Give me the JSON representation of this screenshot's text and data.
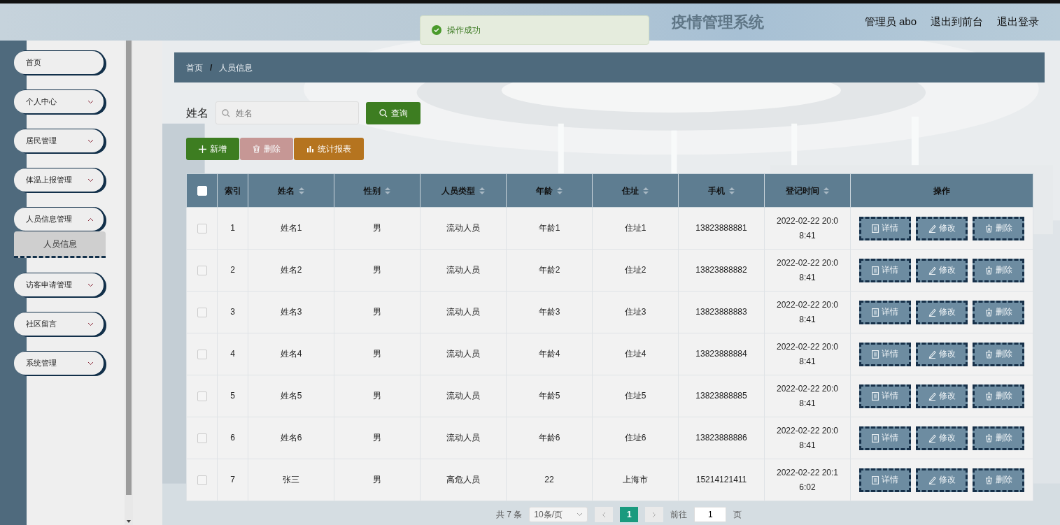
{
  "header": {
    "title": "疫情管理系统",
    "toast": {
      "kind": "success",
      "text": "操作成功"
    },
    "user_links": [
      "管理员 abo",
      "退出到前台",
      "退出登录"
    ]
  },
  "sidebar": {
    "items": [
      {
        "label": "首页",
        "kind": "link"
      },
      {
        "label": "个人中心",
        "kind": "submenu",
        "expanded": false
      },
      {
        "label": "居民管理",
        "kind": "submenu",
        "expanded": false
      },
      {
        "label": "体温上报管理",
        "kind": "submenu",
        "expanded": false
      },
      {
        "label": "人员信息管理",
        "kind": "submenu",
        "expanded": true,
        "children": [
          {
            "label": "人员信息",
            "selected": true
          }
        ]
      },
      {
        "label": "访客申请管理",
        "kind": "submenu",
        "expanded": false
      },
      {
        "label": "社区留言",
        "kind": "submenu",
        "expanded": false
      },
      {
        "label": "系统管理",
        "kind": "submenu",
        "expanded": false
      }
    ]
  },
  "breadcrumb": [
    "首页",
    "人员信息"
  ],
  "breadcrumb_separator": "/",
  "search": {
    "label": "姓名",
    "placeholder": "姓名",
    "button": "查询"
  },
  "toolbar_buttons": [
    {
      "label": "新增",
      "kind": "add",
      "disabled": false
    },
    {
      "label": "删除",
      "kind": "delete",
      "disabled": true
    },
    {
      "label": "统计报表",
      "kind": "report",
      "disabled": false
    }
  ],
  "table": {
    "select_all_checked": false,
    "columns": [
      {
        "label": "索引",
        "sortable": false
      },
      {
        "label": "姓名",
        "sortable": true
      },
      {
        "label": "性别",
        "sortable": true
      },
      {
        "label": "人员类型",
        "sortable": true
      },
      {
        "label": "年龄",
        "sortable": true
      },
      {
        "label": "住址",
        "sortable": true
      },
      {
        "label": "手机",
        "sortable": true
      },
      {
        "label": "登记时间",
        "sortable": true
      },
      {
        "label": "操作",
        "sortable": false
      }
    ],
    "rows": [
      {
        "checked": false,
        "cells": [
          "1",
          "姓名1",
          "男",
          "流动人员",
          "年龄1",
          "住址1",
          "13823888881",
          "2022-02-22 20:08:41"
        ],
        "actions": [
          {
            "label": "详情",
            "kind": "detail"
          },
          {
            "label": "修改",
            "kind": "edit"
          },
          {
            "label": "删除",
            "kind": "delete"
          }
        ]
      },
      {
        "checked": false,
        "cells": [
          "2",
          "姓名2",
          "男",
          "流动人员",
          "年龄2",
          "住址2",
          "13823888882",
          "2022-02-22 20:08:41"
        ],
        "actions": [
          {
            "label": "详情",
            "kind": "detail"
          },
          {
            "label": "修改",
            "kind": "edit"
          },
          {
            "label": "删除",
            "kind": "delete"
          }
        ]
      },
      {
        "checked": false,
        "cells": [
          "3",
          "姓名3",
          "男",
          "流动人员",
          "年龄3",
          "住址3",
          "13823888883",
          "2022-02-22 20:08:41"
        ],
        "actions": [
          {
            "label": "详情",
            "kind": "detail"
          },
          {
            "label": "修改",
            "kind": "edit"
          },
          {
            "label": "删除",
            "kind": "delete"
          }
        ]
      },
      {
        "checked": false,
        "cells": [
          "4",
          "姓名4",
          "男",
          "流动人员",
          "年龄4",
          "住址4",
          "13823888884",
          "2022-02-22 20:08:41"
        ],
        "actions": [
          {
            "label": "详情",
            "kind": "detail"
          },
          {
            "label": "修改",
            "kind": "edit"
          },
          {
            "label": "删除",
            "kind": "delete"
          }
        ]
      },
      {
        "checked": false,
        "cells": [
          "5",
          "姓名5",
          "男",
          "流动人员",
          "年龄5",
          "住址5",
          "13823888885",
          "2022-02-22 20:08:41"
        ],
        "actions": [
          {
            "label": "详情",
            "kind": "detail"
          },
          {
            "label": "修改",
            "kind": "edit"
          },
          {
            "label": "删除",
            "kind": "delete"
          }
        ]
      },
      {
        "checked": false,
        "cells": [
          "6",
          "姓名6",
          "男",
          "流动人员",
          "年龄6",
          "住址6",
          "13823888886",
          "2022-02-22 20:08:41"
        ],
        "actions": [
          {
            "label": "详情",
            "kind": "detail"
          },
          {
            "label": "修改",
            "kind": "edit"
          },
          {
            "label": "删除",
            "kind": "delete"
          }
        ]
      },
      {
        "checked": false,
        "cells": [
          "7",
          "张三",
          "男",
          "高危人员",
          "22",
          "上海市",
          "15214121411",
          "2022-02-22 20:16:02"
        ],
        "actions": [
          {
            "label": "详情",
            "kind": "detail"
          },
          {
            "label": "修改",
            "kind": "edit"
          },
          {
            "label": "删除",
            "kind": "delete"
          }
        ]
      }
    ]
  },
  "pagination": {
    "total": "共 7 条",
    "page_size": "10条/页",
    "pages": [
      {
        "label": "1",
        "selected": true
      }
    ],
    "goto_label": "前往",
    "goto_value": "1",
    "page_suffix": "页"
  }
}
